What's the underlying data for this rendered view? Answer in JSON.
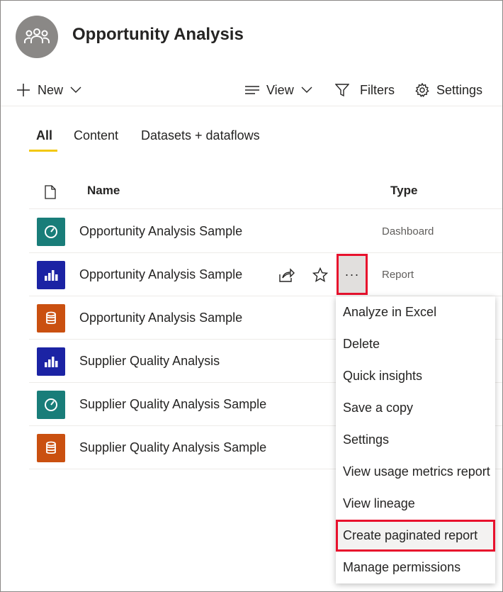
{
  "workspace": {
    "title": "Opportunity Analysis",
    "avatar_icon": "people-group-icon",
    "avatar_color": "#8a8886"
  },
  "toolbar": {
    "new_label": "New",
    "view_label": "View",
    "filters_label": "Filters",
    "settings_label": "Settings"
  },
  "tabs": [
    {
      "label": "All",
      "selected": true
    },
    {
      "label": "Content",
      "selected": false
    },
    {
      "label": "Datasets + dataflows",
      "selected": false
    }
  ],
  "table": {
    "columns": {
      "name": "Name",
      "type": "Type"
    },
    "rows": [
      {
        "name": "Opportunity Analysis Sample",
        "type": "Dashboard",
        "icon": "dashboard-icon",
        "color": "#197d79"
      },
      {
        "name": "Opportunity Analysis Sample",
        "type": "Report",
        "icon": "report-icon",
        "color": "#1b23a4"
      },
      {
        "name": "Opportunity Analysis Sample",
        "type": "",
        "icon": "dataset-icon",
        "color": "#ca5010"
      },
      {
        "name": "Supplier Quality Analysis",
        "type": "",
        "icon": "report-icon",
        "color": "#1b23a4"
      },
      {
        "name": "Supplier Quality Analysis Sample",
        "type": "",
        "icon": "dashboard-icon",
        "color": "#197d79"
      },
      {
        "name": "Supplier Quality Analysis Sample",
        "type": "",
        "icon": "dataset-icon",
        "color": "#ca5010"
      }
    ]
  },
  "more_options": "···",
  "context_menu": {
    "items": [
      {
        "label": "Analyze in Excel",
        "highlighted": false
      },
      {
        "label": "Delete",
        "highlighted": false
      },
      {
        "label": "Quick insights",
        "highlighted": false
      },
      {
        "label": "Save a copy",
        "highlighted": false
      },
      {
        "label": "Settings",
        "highlighted": false
      },
      {
        "label": "View usage metrics report",
        "highlighted": false
      },
      {
        "label": "View lineage",
        "highlighted": false
      },
      {
        "label": "Create paginated report",
        "highlighted": true
      },
      {
        "label": "Manage permissions",
        "highlighted": false
      }
    ]
  },
  "colors": {
    "highlight_border": "#e8112d",
    "tab_underline": "#f2c811"
  }
}
